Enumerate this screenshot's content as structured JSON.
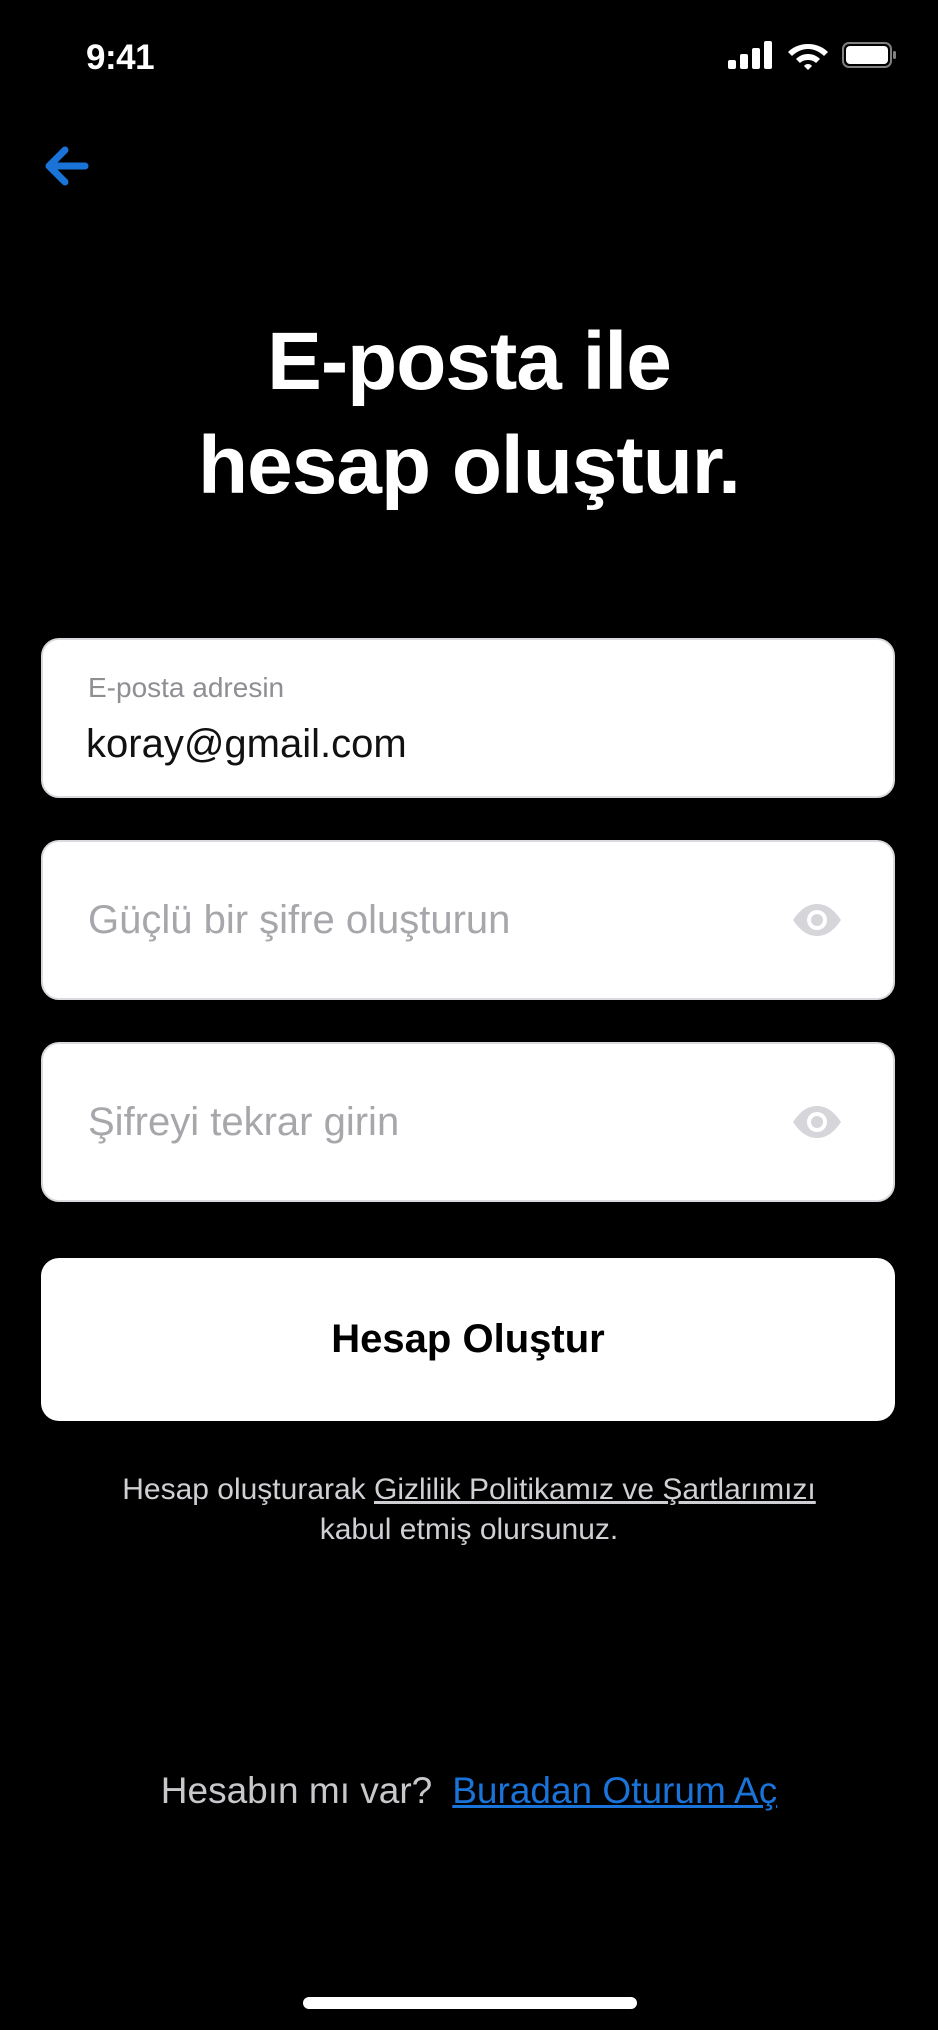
{
  "status_bar": {
    "time": "9:41"
  },
  "icons": {
    "back": "arrow-left-icon",
    "signal": "cellular-signal-icon",
    "wifi": "wifi-icon",
    "battery": "battery-icon",
    "eye": "eye-icon"
  },
  "colors": {
    "background": "#000000",
    "accent": "#1a73d9",
    "field_background": "#ffffff",
    "placeholder": "#a6a6ab"
  },
  "header": {
    "title_line1": "E-posta ile",
    "title_line2": "hesap oluştur."
  },
  "form": {
    "email": {
      "label": "E-posta adresin",
      "value": "koray@gmail.com"
    },
    "password": {
      "placeholder": "Güçlü bir şifre oluşturun"
    },
    "password_confirm": {
      "placeholder": "Şifreyi tekrar girin"
    },
    "submit_label": "Hesap Oluştur"
  },
  "terms": {
    "prefix": "Hesap oluşturarak ",
    "link": "Gizlilik Politikamız ve Şartlarımızı",
    "suffix": "kabul etmiş olursunuz."
  },
  "signin": {
    "prompt": "Hesabın mı var?",
    "link": "Buradan Oturum Aç"
  }
}
